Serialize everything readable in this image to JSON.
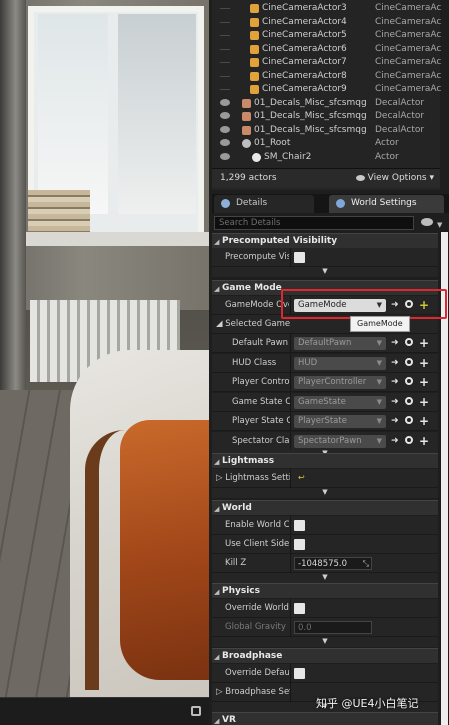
{
  "outliner": {
    "rows": [
      {
        "name": "CineCameraActor3",
        "type": "CineCameraAc",
        "visible": false,
        "kind": "camera"
      },
      {
        "name": "CineCameraActor4",
        "type": "CineCameraAc",
        "visible": false,
        "kind": "camera"
      },
      {
        "name": "CineCameraActor5",
        "type": "CineCameraAc",
        "visible": false,
        "kind": "camera"
      },
      {
        "name": "CineCameraActor6",
        "type": "CineCameraAc",
        "visible": false,
        "kind": "camera"
      },
      {
        "name": "CineCameraActor7",
        "type": "CineCameraAc",
        "visible": false,
        "kind": "camera"
      },
      {
        "name": "CineCameraActor8",
        "type": "CineCameraAc",
        "visible": false,
        "kind": "camera"
      },
      {
        "name": "CineCameraActor9",
        "type": "CineCameraAc",
        "visible": false,
        "kind": "camera"
      },
      {
        "name": "01_Decals_Misc_sfcsmqg",
        "type": "DecalActor",
        "visible": true,
        "kind": "decal"
      },
      {
        "name": "01_Decals_Misc_sfcsmqg",
        "type": "DecalActor",
        "visible": true,
        "kind": "decal"
      },
      {
        "name": "01_Decals_Misc_sfcsmqg",
        "type": "DecalActor",
        "visible": true,
        "kind": "decal"
      },
      {
        "name": "01_Root",
        "type": "Actor",
        "visible": true,
        "kind": "root"
      },
      {
        "name": "SM_Chair2",
        "type": "Actor",
        "visible": true,
        "kind": "sphere"
      }
    ],
    "actor_count": "1,299 actors",
    "view_options": "View Options"
  },
  "tabs": {
    "details": "Details",
    "world_settings": "World Settings"
  },
  "search": {
    "placeholder": "Search Details"
  },
  "sections": {
    "precomputed_visibility": {
      "title": "Precomputed Visibility",
      "precompute_label": "Precompute Visil"
    },
    "game_mode": {
      "title": "Game Mode",
      "override_label": "GameMode Over",
      "override_value": "GameMode",
      "tooltip": "GameMode",
      "selected_label": "Selected GameM",
      "rows": [
        {
          "label": "Default Pawn C",
          "value": "DefaultPawn"
        },
        {
          "label": "HUD Class",
          "value": "HUD"
        },
        {
          "label": "Player Controll",
          "value": "PlayerController"
        },
        {
          "label": "Game State Cl",
          "value": "GameState"
        },
        {
          "label": "Player State Cl",
          "value": "PlayerState"
        },
        {
          "label": "Spectator Clas",
          "value": "SpectatorPawn"
        }
      ]
    },
    "lightmass": {
      "title": "Lightmass",
      "settings_label": "Lightmass Settin"
    },
    "world": {
      "title": "World",
      "enable_world_label": "Enable World Con",
      "use_client_label": "Use Client Side L",
      "kill_z_label": "Kill Z",
      "kill_z_value": "-1048575.0"
    },
    "physics": {
      "title": "Physics",
      "override_gravity_label": "Override World Gi",
      "global_gravity_label": "Global Gravity Z",
      "global_gravity_value": "0.0"
    },
    "broadphase": {
      "title": "Broadphase",
      "override_default_label": "Override Default",
      "settings_label": "Broadphase Setti"
    },
    "vr": {
      "title": "VR"
    }
  },
  "watermark": "知乎 @UE4小白笔记",
  "colors": {
    "highlight": "#e0272d",
    "panel": "#252525",
    "header": "#303030"
  }
}
